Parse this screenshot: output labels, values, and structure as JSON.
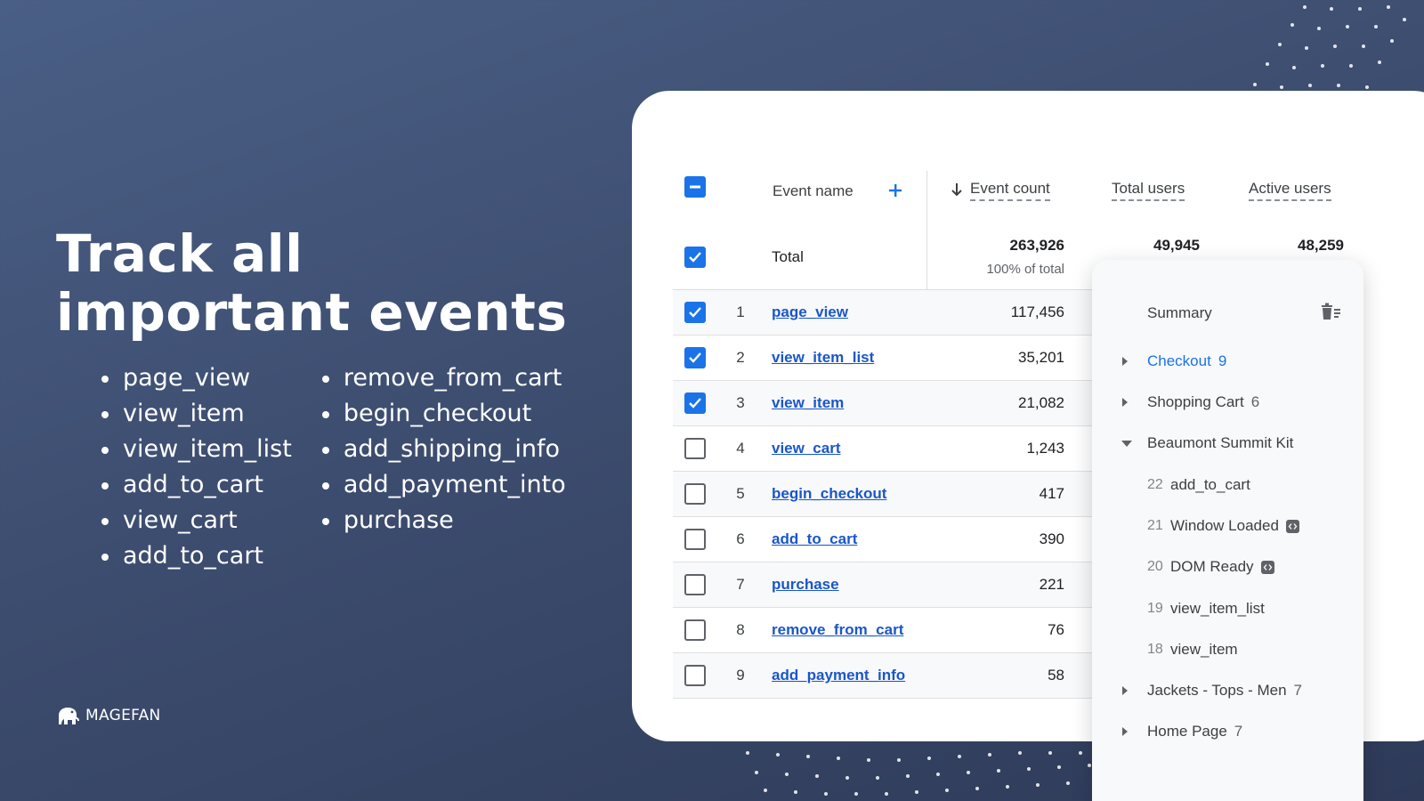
{
  "headline": {
    "line1": "Track all",
    "line2": "important events"
  },
  "events_col1": [
    "page_view",
    "view_item",
    "view_item_list",
    "add_to_cart",
    "view_cart",
    "add_to_cart"
  ],
  "events_col2": [
    "remove_from_cart",
    "begin_checkout",
    "add_shipping_info",
    "add_payment_into",
    "purchase"
  ],
  "logo": {
    "text": "MAGEFAN",
    "icon": "elephant-logo-icon"
  },
  "table": {
    "headers": {
      "event_name": "Event name",
      "event_count": "Event count",
      "total_users": "Total users",
      "active_users": "Active users"
    },
    "total": {
      "label": "Total",
      "event_count": "263,926",
      "event_count_pct": "100% of total",
      "total_users": "49,945",
      "active_users": "48,259"
    },
    "rows": [
      {
        "rank": "1",
        "name": "page_view",
        "count": "117,456",
        "checked": true
      },
      {
        "rank": "2",
        "name": "view_item_list",
        "count": "35,201",
        "checked": true
      },
      {
        "rank": "3",
        "name": "view_item",
        "count": "21,082",
        "checked": true
      },
      {
        "rank": "4",
        "name": "view_cart",
        "count": "1,243",
        "checked": false
      },
      {
        "rank": "5",
        "name": "begin_checkout",
        "count": "417",
        "checked": false
      },
      {
        "rank": "6",
        "name": "add_to_cart",
        "count": "390",
        "checked": false
      },
      {
        "rank": "7",
        "name": "purchase",
        "count": "221",
        "checked": false
      },
      {
        "rank": "8",
        "name": "remove_from_cart",
        "count": "76",
        "checked": false
      },
      {
        "rank": "9",
        "name": "add_payment_info",
        "count": "58",
        "checked": false
      }
    ]
  },
  "summary": {
    "title": "Summary",
    "items": [
      {
        "label": "Checkout",
        "count": "9",
        "expanded": false,
        "active": true
      },
      {
        "label": "Shopping Cart",
        "count": "6",
        "expanded": false,
        "active": false
      },
      {
        "label": "Beaumont Summit Kit",
        "count": "",
        "expanded": true,
        "active": false
      }
    ],
    "subitems": [
      {
        "num": "22",
        "label": "add_to_cart",
        "badge": false
      },
      {
        "num": "21",
        "label": "Window Loaded",
        "badge": true
      },
      {
        "num": "20",
        "label": "DOM Ready",
        "badge": true
      },
      {
        "num": "19",
        "label": "view_item_list",
        "badge": false
      },
      {
        "num": "18",
        "label": "view_item",
        "badge": false
      }
    ],
    "items_after": [
      {
        "label": "Jackets - Tops - Men",
        "count": "7"
      },
      {
        "label": "Home Page",
        "count": "7"
      }
    ]
  },
  "colors": {
    "accent": "#1a73e8",
    "link": "#1a56c9",
    "bg_top": "#4a5f86",
    "bg_bottom": "#2e3a58"
  }
}
